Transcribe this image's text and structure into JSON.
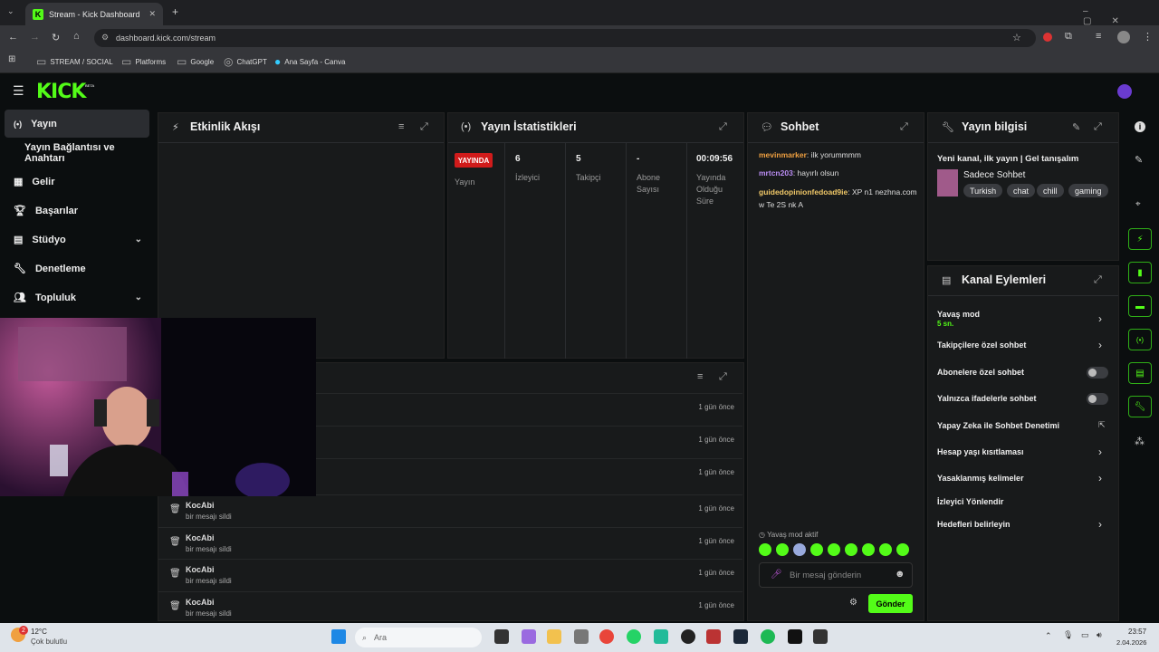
{
  "browser": {
    "tab_title": "Stream - Kick Dashboard",
    "url": "dashboard.kick.com/stream",
    "bookmarks": [
      "STREAM / SOCIAL",
      "Platforms",
      "Google",
      "ChatGPT",
      "Ana Sayfa - Canva"
    ]
  },
  "header": {
    "logo": "KICK",
    "beta": "BETA"
  },
  "sidebar": {
    "items": [
      {
        "label": "Yayın",
        "icon": "broadcast-icon"
      },
      {
        "label": "Yayın Bağlantısı ve Anahtarı"
      },
      {
        "label": "Gelir",
        "icon": "chart-icon"
      },
      {
        "label": "Başarılar",
        "icon": "trophy-icon"
      },
      {
        "label": "Stüdyo",
        "icon": "studio-icon"
      },
      {
        "label": "Denetleme",
        "icon": "wrench-icon"
      },
      {
        "label": "Topluluk",
        "icon": "people-icon"
      }
    ]
  },
  "activity": {
    "title": "Etkinlik Akışı"
  },
  "stats": {
    "title": "Yayın İstatistikleri",
    "status_badge": "YAYINDA",
    "status_label": "Yayın",
    "viewers_value": "6",
    "viewers_label": "İzleyici",
    "followers_value": "5",
    "followers_label": "Takipçi",
    "subs_value": "-",
    "subs_label": "Abone Sayısı",
    "uptime_value": "00:09:56",
    "uptime_label": "Yayında Olduğu Süre"
  },
  "feed": {
    "rows": [
      {
        "user": "",
        "action": "",
        "time": "1 gün önce"
      },
      {
        "user": "",
        "action": "",
        "time": "1 gün önce"
      },
      {
        "user": "",
        "action": "",
        "time": "1 gün önce"
      },
      {
        "user": "KocAbi",
        "action": "bir mesajı sildi",
        "time": "1 gün önce"
      },
      {
        "user": "KocAbi",
        "action": "bir mesajı sildi",
        "time": "1 gün önce"
      },
      {
        "user": "KocAbi",
        "action": "bir mesajı sildi",
        "time": "1 gün önce"
      },
      {
        "user": "KocAbi",
        "action": "bir mesajı sildi",
        "time": "1 gün önce"
      }
    ]
  },
  "chat": {
    "title": "Sohbet",
    "messages": [
      {
        "user": "mevinmarker",
        "color": "#f0a040",
        "text": "ilk yorummmm"
      },
      {
        "user": "mrtcn203",
        "color": "#b98cf2",
        "text": "hayırlı olsun"
      },
      {
        "user": "guidedopinionfedoad9ie",
        "color": "#f0c868",
        "text": "XP n1 nezhna.com w Te 2S nk A"
      }
    ],
    "slow_mode_notice": "Yavaş mod aktif",
    "input_placeholder": "Bir mesaj gönderin",
    "send_label": "Gönder"
  },
  "stream_info": {
    "title": "Yayın bilgisi",
    "stream_title": "Yeni kanal, ilk yayın | Gel tanışalım",
    "category": "Sadece Sohbet",
    "tags": [
      "Turkish",
      "chat",
      "chill",
      "gaming"
    ]
  },
  "channel_actions": {
    "title": "Kanal Eylemleri",
    "slow_mode_label": "Yavaş mod",
    "slow_mode_value": "5 sn.",
    "items": [
      "Takipçilere özel sohbet",
      "Abonelere özel sohbet",
      "Yalnızca ifadelerle sohbet",
      "Yapay Zeka ile Sohbet Denetimi",
      "Hesap yaşı kısıtlaması",
      "Yasaklanmış kelimeler",
      "İzleyici Yönlendir",
      "Hedefleri belirleyin"
    ]
  },
  "taskbar": {
    "temp": "12°C",
    "weather": "Çok bulutlu",
    "search": "Ara",
    "time": "23:57",
    "date": "2.04.2026",
    "notif_count": "2"
  },
  "colors": {
    "accent": "#53fc18",
    "live": "#d01b1b",
    "panel": "#181a1b",
    "bg": "#0b0e0f"
  }
}
